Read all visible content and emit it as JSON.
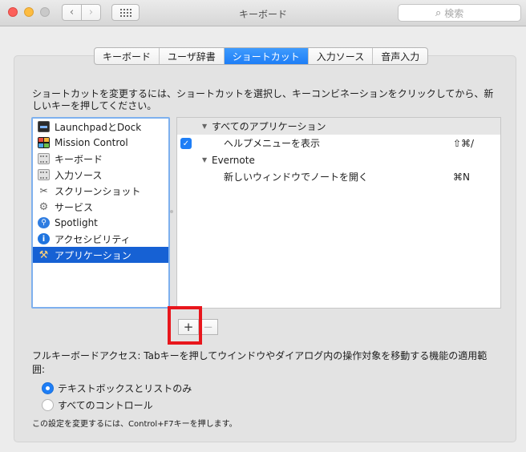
{
  "window": {
    "title": "キーボード",
    "search_placeholder": "検索"
  },
  "tabs": [
    {
      "label": "キーボード",
      "active": false
    },
    {
      "label": "ユーザ辞書",
      "active": false
    },
    {
      "label": "ショートカット",
      "active": true
    },
    {
      "label": "入力ソース",
      "active": false
    },
    {
      "label": "音声入力",
      "active": false
    }
  ],
  "instruction": "ショートカットを変更するには、ショートカットを選択し、キーコンビネーションをクリックしてから、新しいキーを押してください。",
  "categories": [
    {
      "label": "LaunchpadとDock",
      "icon": "launchpad-icon"
    },
    {
      "label": "Mission Control",
      "icon": "mission-control-icon"
    },
    {
      "label": "キーボード",
      "icon": "keyboard-icon"
    },
    {
      "label": "入力ソース",
      "icon": "keyboard-icon"
    },
    {
      "label": "スクリーンショット",
      "icon": "screenshot-icon"
    },
    {
      "label": "サービス",
      "icon": "gear-icon"
    },
    {
      "label": "Spotlight",
      "icon": "spotlight-icon"
    },
    {
      "label": "アクセシビリティ",
      "icon": "accessibility-icon"
    },
    {
      "label": "アプリケーション",
      "icon": "app-store-icon",
      "selected": true
    }
  ],
  "shortcuts": {
    "group_all": "すべてのアプリケーション",
    "item_help": {
      "label": "ヘルプメニューを表示",
      "keys": "⇧⌘/",
      "checked": true
    },
    "group_evernote": "Evernote",
    "item_note": {
      "label": "新しいウィンドウでノートを開く",
      "keys": "⌘N"
    }
  },
  "buttons": {
    "add": "+",
    "remove": "−"
  },
  "full_keyboard_access": {
    "text": "フルキーボードアクセス: Tabキーを押してウインドウやダイアログ内の操作対象を移動する機能の適用範囲:",
    "option_text_lists": "テキストボックスとリストのみ",
    "option_all": "すべてのコントロール",
    "selected": "テキストボックスとリストのみ"
  },
  "footnote": "この設定を変更するには、Control+F7キーを押します。",
  "colors": {
    "accent": "#1e7ef6",
    "selection": "#1661d4",
    "highlight_box": "#e8161c"
  }
}
